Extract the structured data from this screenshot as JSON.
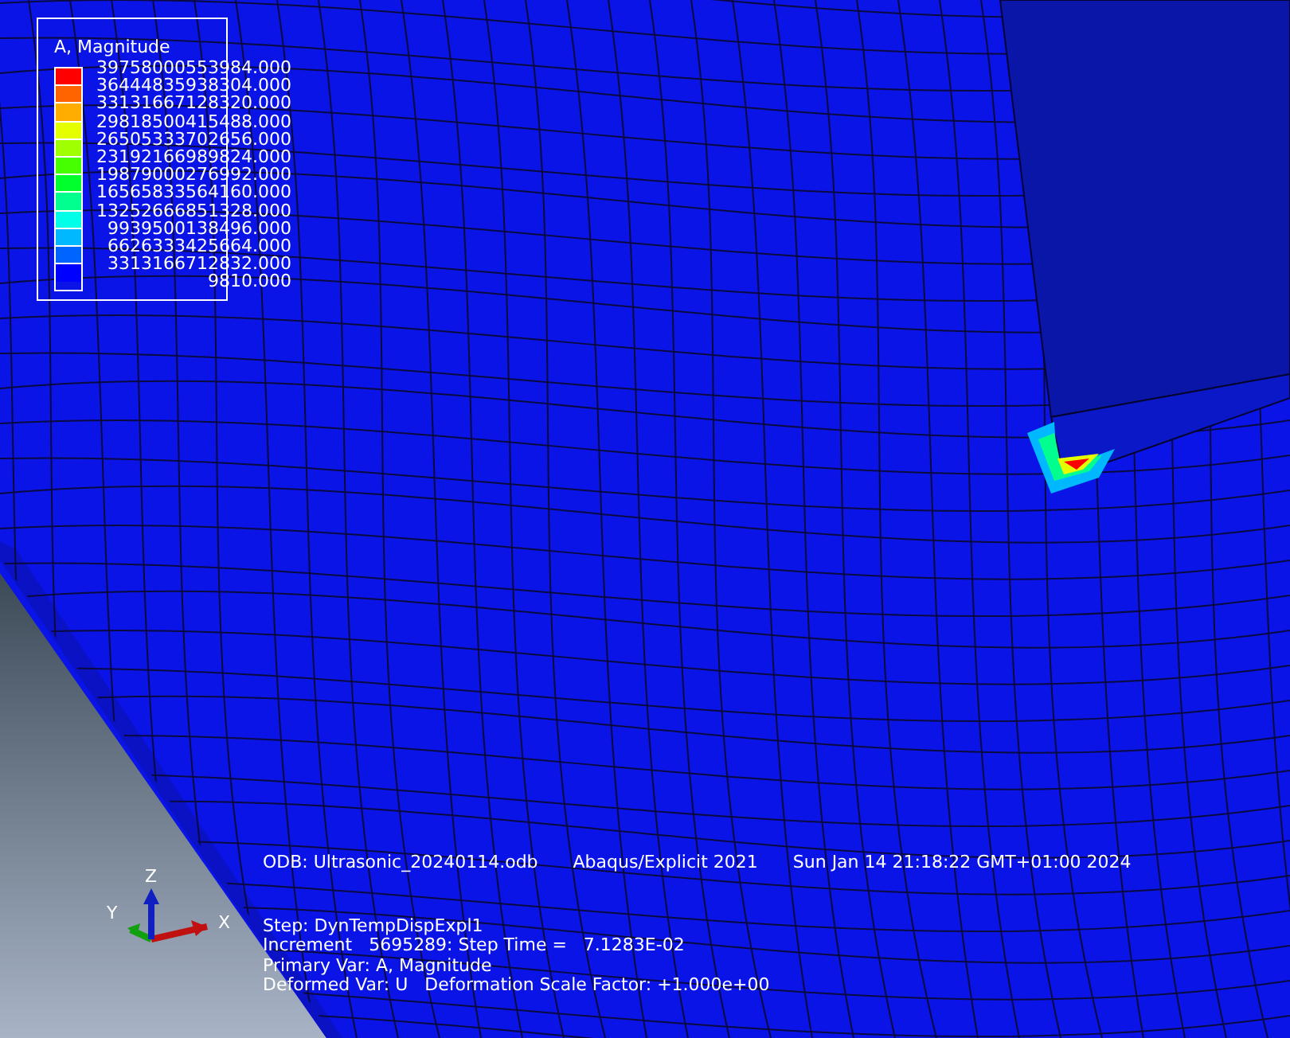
{
  "legend": {
    "title": "A, Magnitude",
    "bands": [
      {
        "color": "#ff0000"
      },
      {
        "color": "#ff6400"
      },
      {
        "color": "#ffad00"
      },
      {
        "color": "#e6ff00"
      },
      {
        "color": "#a0ff00"
      },
      {
        "color": "#46ff00"
      },
      {
        "color": "#00ff2c"
      },
      {
        "color": "#00ff8e"
      },
      {
        "color": "#00ffe6"
      },
      {
        "color": "#00b8ff"
      },
      {
        "color": "#0064ff"
      },
      {
        "color": "#0000ff"
      }
    ],
    "labels": [
      "39758000553984.000",
      "36444835938304.000",
      "33131667128320.000",
      "29818500415488.000",
      "26505333702656.000",
      "23192166989824.000",
      "19879000276992.000",
      "16565833564160.000",
      "13252666851328.000",
      "9939500138496.000",
      "6626333425664.000",
      "3313166712832.000",
      "9810.000"
    ]
  },
  "info": {
    "header": [
      "ODB: Ultrasonic_20240114.odb",
      "Abaqus/Explicit 2021",
      "Sun Jan 14 21:18:22 GMT+01:00 2024"
    ],
    "lines": [
      "Step: DynTempDispExpl1",
      "Increment   5695289: Step Time =   7.1283E-02",
      "Primary Var: A, Magnitude",
      "Deformed Var: U   Deformation Scale Factor: +1.000e+00"
    ]
  },
  "triad": {
    "axes": [
      {
        "label": "X",
        "color": "#c01010"
      },
      {
        "label": "Y",
        "color": "#10a010"
      },
      {
        "label": "Z",
        "color": "#1020c0"
      }
    ]
  }
}
